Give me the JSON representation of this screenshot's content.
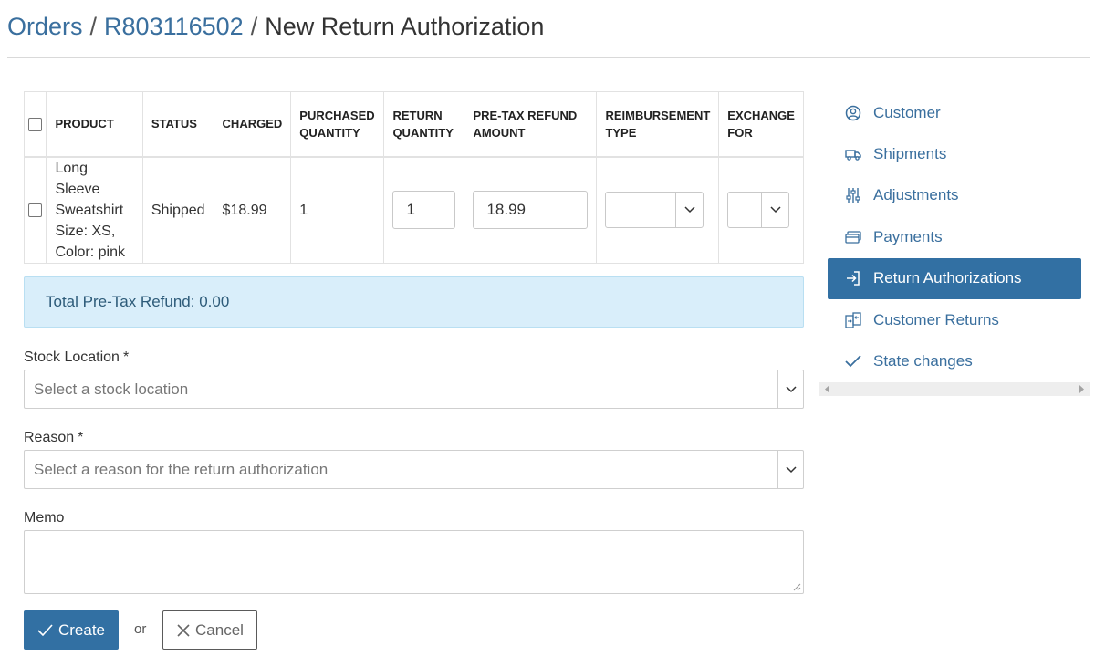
{
  "breadcrumb": {
    "orders": "Orders",
    "sep1": "/",
    "order_number": "R803116502",
    "sep2": "/",
    "current": "New Return Authorization"
  },
  "table": {
    "headers": {
      "product": "PRODUCT",
      "status": "STATUS",
      "charged": "CHARGED",
      "purchased_qty_1": "PURCHASED",
      "purchased_qty_2": "QUANTITY",
      "return_qty_1": "RETURN",
      "return_qty_2": "QUANTITY",
      "refund_1": "PRE-TAX REFUND",
      "refund_2": "AMOUNT",
      "reimb_1": "REIMBURSEMENT",
      "reimb_2": "TYPE",
      "exchange_1": "EXCHANGE",
      "exchange_2": "FOR"
    },
    "row": {
      "product_line1": "Long Sleeve",
      "product_line2": "Sweatshirt",
      "product_line3": "Size: XS,",
      "product_line4": "Color: pink",
      "status": "Shipped",
      "charged": "$18.99",
      "purchased_quantity": "1",
      "return_quantity": "1",
      "refund_amount": "18.99"
    }
  },
  "total": {
    "label": "Total Pre-Tax Refund: 0.00"
  },
  "form": {
    "stock_location_label": "Stock Location",
    "stock_location_placeholder": "Select a stock location",
    "reason_label": "Reason",
    "reason_placeholder": "Select a reason for the return authorization",
    "required_mark": "*",
    "memo_label": "Memo",
    "memo_value": ""
  },
  "actions": {
    "create_label": "Create",
    "or_text": "or",
    "cancel_label": "Cancel"
  },
  "sidebar": {
    "items": [
      {
        "label": "Customer",
        "icon": "user-circle-icon"
      },
      {
        "label": "Shipments",
        "icon": "truck-icon"
      },
      {
        "label": "Adjustments",
        "icon": "sliders-icon"
      },
      {
        "label": "Payments",
        "icon": "credit-card-icon"
      },
      {
        "label": "Return Authorizations",
        "icon": "sign-in-icon",
        "active": true
      },
      {
        "label": "Customer Returns",
        "icon": "exchange-icon"
      },
      {
        "label": "State changes",
        "icon": "checkmark-icon"
      }
    ]
  },
  "colors": {
    "accent": "#3270a3",
    "link": "#3a6f9e",
    "info_bg": "#d9eefa"
  }
}
